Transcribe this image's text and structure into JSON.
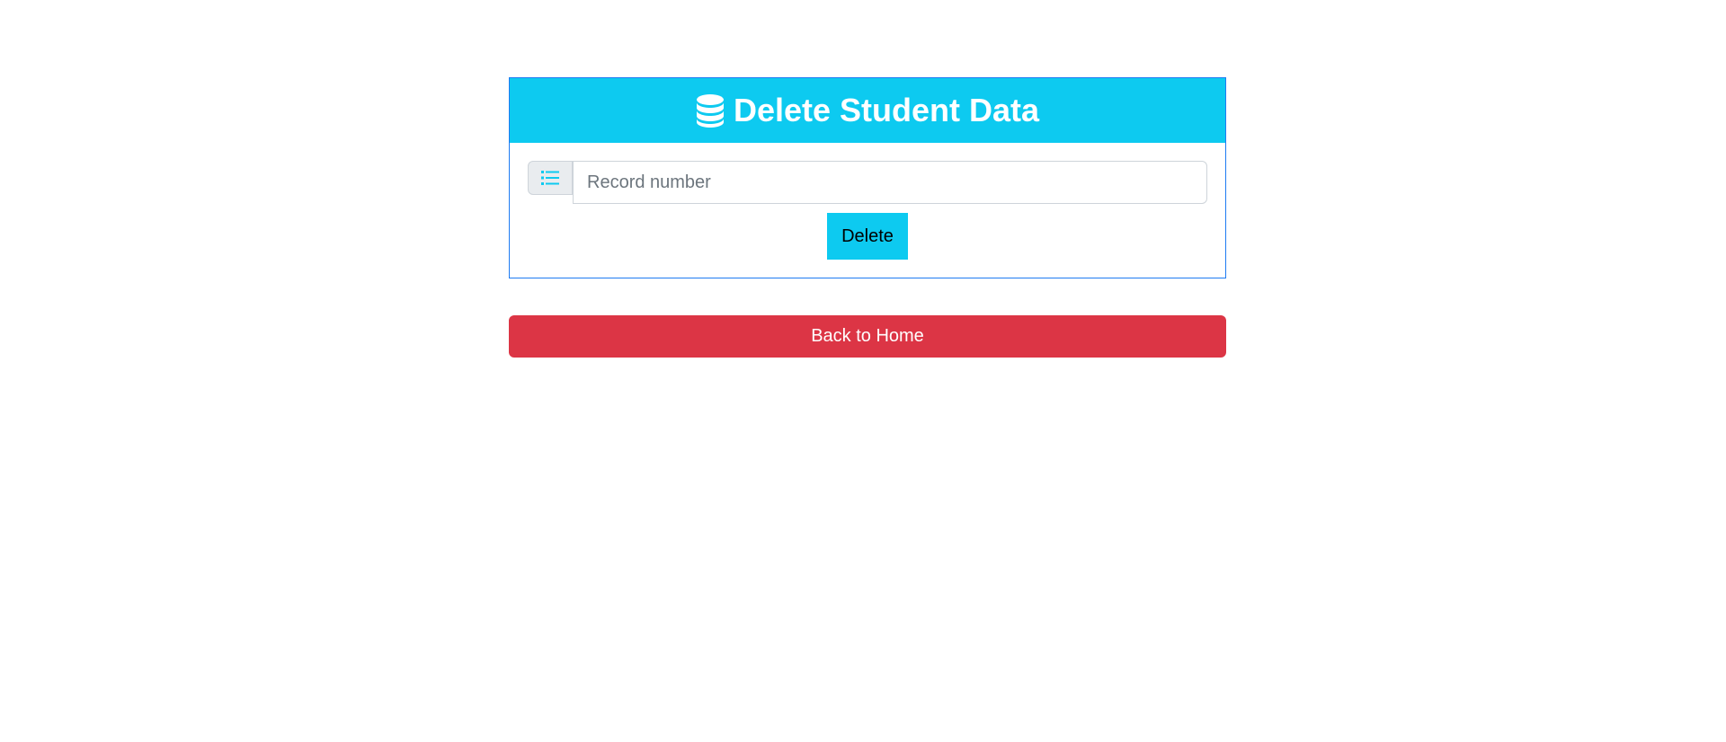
{
  "card": {
    "title": "Delete Student Data",
    "title_icon": "database-icon"
  },
  "form": {
    "input_icon": "list-icon",
    "record_input_placeholder": "Record number",
    "record_input_value": "",
    "delete_label": "Delete"
  },
  "navigation": {
    "back_home_label": "Back to Home"
  },
  "colors": {
    "header_bg": "#0dcaf0",
    "card_border": "#1e7bf2",
    "delete_bg": "#0dcaf0",
    "back_home_bg": "#dc3545"
  }
}
